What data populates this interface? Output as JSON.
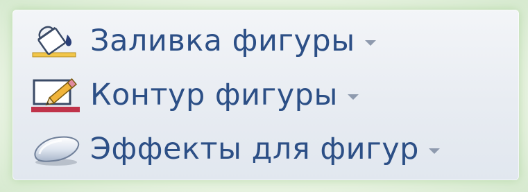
{
  "menu": {
    "items": [
      {
        "label": "Заливка фигуры",
        "icon": "fill-bucket-icon",
        "has_dropdown": true
      },
      {
        "label": "Контур фигуры",
        "icon": "pencil-outline-icon",
        "has_dropdown": true
      },
      {
        "label": "Эффекты для фигур",
        "icon": "shape-effects-icon",
        "has_dropdown": true
      }
    ]
  },
  "colors": {
    "label_text": "#2c4f86",
    "outline_bar": "#c0334a",
    "panel_bg": "#e8ecf2",
    "glow": "#96c882"
  }
}
